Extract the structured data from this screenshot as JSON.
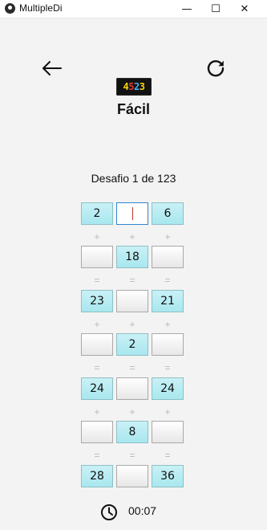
{
  "window": {
    "title": "MultipleDi",
    "controls": {
      "minimize": "—",
      "maximize": "☐",
      "close": "✕"
    }
  },
  "header": {
    "back_icon": "arrow-left-icon",
    "reload_icon": "reload-icon",
    "logo": {
      "digits": [
        "4",
        "5",
        "2",
        "3"
      ],
      "colors": [
        "#f7d200",
        "#e53935",
        "#42b3ff",
        "#f7d200"
      ]
    },
    "difficulty": "Fácil",
    "challenge_text": "Desafio 1 de 123"
  },
  "puzzle": {
    "rows": [
      {
        "type": "cells",
        "cells": [
          {
            "value": "2",
            "state": "filled"
          },
          {
            "value": "",
            "state": "active"
          },
          {
            "value": "6",
            "state": "filled"
          }
        ]
      },
      {
        "type": "ops",
        "ops": [
          "+",
          "+",
          "+"
        ]
      },
      {
        "type": "cells",
        "cells": [
          {
            "value": "",
            "state": "empty"
          },
          {
            "value": "18",
            "state": "filled"
          },
          {
            "value": "",
            "state": "empty"
          }
        ]
      },
      {
        "type": "ops",
        "ops": [
          "=",
          "=",
          "="
        ]
      },
      {
        "type": "cells",
        "cells": [
          {
            "value": "23",
            "state": "filled"
          },
          {
            "value": "",
            "state": "empty"
          },
          {
            "value": "21",
            "state": "filled"
          }
        ]
      },
      {
        "type": "ops",
        "ops": [
          "+",
          "+",
          "+"
        ]
      },
      {
        "type": "cells",
        "cells": [
          {
            "value": "",
            "state": "empty"
          },
          {
            "value": "2",
            "state": "filled"
          },
          {
            "value": "",
            "state": "empty"
          }
        ]
      },
      {
        "type": "ops",
        "ops": [
          "=",
          "=",
          "="
        ]
      },
      {
        "type": "cells",
        "cells": [
          {
            "value": "24",
            "state": "filled"
          },
          {
            "value": "",
            "state": "empty"
          },
          {
            "value": "24",
            "state": "filled"
          }
        ]
      },
      {
        "type": "ops",
        "ops": [
          "+",
          "+",
          "+"
        ]
      },
      {
        "type": "cells",
        "cells": [
          {
            "value": "",
            "state": "empty"
          },
          {
            "value": "8",
            "state": "filled"
          },
          {
            "value": "",
            "state": "empty"
          }
        ]
      },
      {
        "type": "ops",
        "ops": [
          "=",
          "=",
          "="
        ]
      },
      {
        "type": "cells",
        "cells": [
          {
            "value": "28",
            "state": "filled"
          },
          {
            "value": "",
            "state": "empty"
          },
          {
            "value": "36",
            "state": "filled"
          }
        ]
      }
    ]
  },
  "timer": {
    "icon": "clock-icon",
    "value": "00:07"
  }
}
